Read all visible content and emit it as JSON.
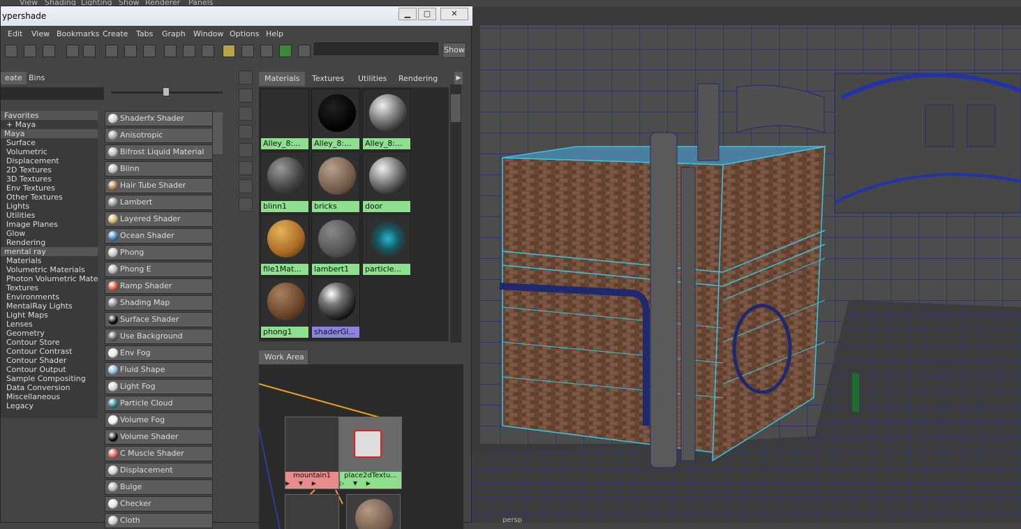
{
  "viewport_menu": [
    "View",
    "Shading",
    "Lighting",
    "Show",
    "Renderer",
    "Panels"
  ],
  "window": {
    "title": "ypershade",
    "min": "▁",
    "max": "▢",
    "close": "✕"
  },
  "menu": [
    "Edit",
    "View",
    "Bookmarks",
    "Create",
    "Tabs",
    "Graph",
    "Window",
    "Options",
    "Help"
  ],
  "toolbar": {
    "show_label": "Show",
    "search_value": ""
  },
  "left_tabs": {
    "create": "eate",
    "bins": "Bins"
  },
  "tree": [
    {
      "label": "Favorites",
      "section": true
    },
    {
      "label": "+ Maya",
      "section": false
    },
    {
      "label": "Maya",
      "section": true
    },
    {
      "label": "Surface",
      "section": false
    },
    {
      "label": "Volumetric",
      "section": false
    },
    {
      "label": "Displacement",
      "section": false
    },
    {
      "label": "2D Textures",
      "section": false
    },
    {
      "label": "3D Textures",
      "section": false
    },
    {
      "label": "Env Textures",
      "section": false
    },
    {
      "label": "Other Textures",
      "section": false
    },
    {
      "label": "Lights",
      "section": false
    },
    {
      "label": "Utilities",
      "section": false
    },
    {
      "label": "Image Planes",
      "section": false
    },
    {
      "label": "Glow",
      "section": false
    },
    {
      "label": "Rendering",
      "section": false
    },
    {
      "label": "mental ray",
      "section": true
    },
    {
      "label": "Materials",
      "section": false
    },
    {
      "label": "Volumetric Materials",
      "section": false
    },
    {
      "label": "Photon Volumetric Materi...",
      "section": false
    },
    {
      "label": "Textures",
      "section": false
    },
    {
      "label": "Environments",
      "section": false
    },
    {
      "label": "MentalRay Lights",
      "section": false
    },
    {
      "label": "Light Maps",
      "section": false
    },
    {
      "label": "Lenses",
      "section": false
    },
    {
      "label": "Geometry",
      "section": false
    },
    {
      "label": "Contour Store",
      "section": false
    },
    {
      "label": "Contour Contrast",
      "section": false
    },
    {
      "label": "Contour Shader",
      "section": false
    },
    {
      "label": "Contour Output",
      "section": false
    },
    {
      "label": "Sample Compositing",
      "section": false
    },
    {
      "label": "Data Conversion",
      "section": false
    },
    {
      "label": "Miscellaneous",
      "section": false
    },
    {
      "label": "Legacy",
      "section": false
    }
  ],
  "nodes": [
    {
      "label": "Shaderfx Shader",
      "color": "#cfcfcf"
    },
    {
      "label": "Anisotropic",
      "color": "#9a9a9a"
    },
    {
      "label": "Bifrost Liquid Material",
      "color": "#b5b5b5"
    },
    {
      "label": "Blinn",
      "color": "#bdbdbd"
    },
    {
      "label": "Hair Tube Shader",
      "color": "#a8743e"
    },
    {
      "label": "Lambert",
      "color": "#8f8f8f"
    },
    {
      "label": "Layered Shader",
      "color": "#c9b06a"
    },
    {
      "label": "Ocean Shader",
      "color": "#3f84c4"
    },
    {
      "label": "Phong",
      "color": "#c2c2c2"
    },
    {
      "label": "Phong E",
      "color": "#b0b0b0"
    },
    {
      "label": "Ramp Shader",
      "color": "#d95c3a"
    },
    {
      "label": "Shading Map",
      "color": "#8a8a8a"
    },
    {
      "label": "Surface Shader",
      "color": "#0a0a0a"
    },
    {
      "label": "Use Background",
      "color": "#5d5d5d"
    },
    {
      "label": "Env Fog",
      "color": "#e8e8e8"
    },
    {
      "label": "Fluid Shape",
      "color": "#8ab4d6"
    },
    {
      "label": "Light Fog",
      "color": "#cfcfcf"
    },
    {
      "label": "Particle Cloud",
      "color": "#2d7f87"
    },
    {
      "label": "Volume Fog",
      "color": "#f0f0f0"
    },
    {
      "label": "Volume Shader",
      "color": "#0a0a0a"
    },
    {
      "label": "C Muscle Shader",
      "color": "#d9604e"
    },
    {
      "label": "Displacement",
      "color": "#d0d0d0"
    },
    {
      "label": "Bulge",
      "color": "#b0b0b0"
    },
    {
      "label": "Checker",
      "color": "#e0e0e0"
    },
    {
      "label": "Cloth",
      "color": "#c8c8c8"
    }
  ],
  "material_tabs": [
    "Materials",
    "Textures",
    "Utilities",
    "Rendering"
  ],
  "swatches": [
    {
      "label": "Alley_8:...",
      "style": "check"
    },
    {
      "label": "Alley_8:...",
      "style": "black"
    },
    {
      "label": "Alley_8:...",
      "style": "gray"
    },
    {
      "label": "blinn1",
      "style": "granite"
    },
    {
      "label": "bricks",
      "style": "brick"
    },
    {
      "label": "door",
      "style": "gray"
    },
    {
      "label": "file1Mat...",
      "style": "wood"
    },
    {
      "label": "lambert1",
      "style": "lambert"
    },
    {
      "label": "particle...",
      "style": "particle"
    },
    {
      "label": "phong1",
      "style": "phong"
    },
    {
      "label": "shaderGl...",
      "style": "shaderglow",
      "selected": true
    }
  ],
  "work_area": {
    "tab": "Work Area",
    "nodes": {
      "mountain": "mountain1",
      "place2d": "place2dTextu..."
    }
  },
  "viewport_camera": "persp"
}
